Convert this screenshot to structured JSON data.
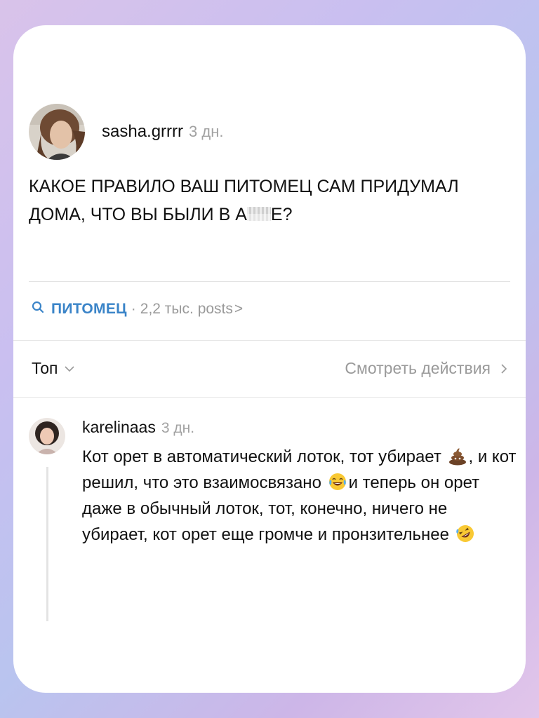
{
  "post": {
    "username": "sasha.grrrr",
    "time": "3 дн.",
    "text_before": "КАКОЕ ПРАВИЛО ВАШ ПИТОМЕЦ САМ ПРИДУМАЛ ДОМА, ЧТО ВЫ БЫЛИ В А",
    "text_after": "Е?",
    "avatar_icon": "user-avatar-photo"
  },
  "tag": {
    "icon": "search-icon",
    "name": "ПИТОМЕЦ",
    "separator": "·",
    "count": "2,2 тыс. posts",
    "chevron": ">"
  },
  "sort": {
    "label": "Топ",
    "actions_label": "Смотреть действия"
  },
  "comment": {
    "username": "karelinaas",
    "time": "3 дн.",
    "text_1": "Кот орет в автоматический лоток, тот убирает",
    "text_2": ", и кот решил, что это взаимосвязано",
    "text_3": "и теперь он орет даже в обычный лоток, тот, конечно, ничего не убирает, кот орет еще громче и пронзительнее",
    "emojis": [
      "pile-of-poo-emoji",
      "tears-of-joy-emoji",
      "rolling-laughing-emoji"
    ]
  },
  "colors": {
    "tag_accent": "#3a84c8",
    "muted_text": "#9a9a9a",
    "card_background": "#ffffff"
  }
}
